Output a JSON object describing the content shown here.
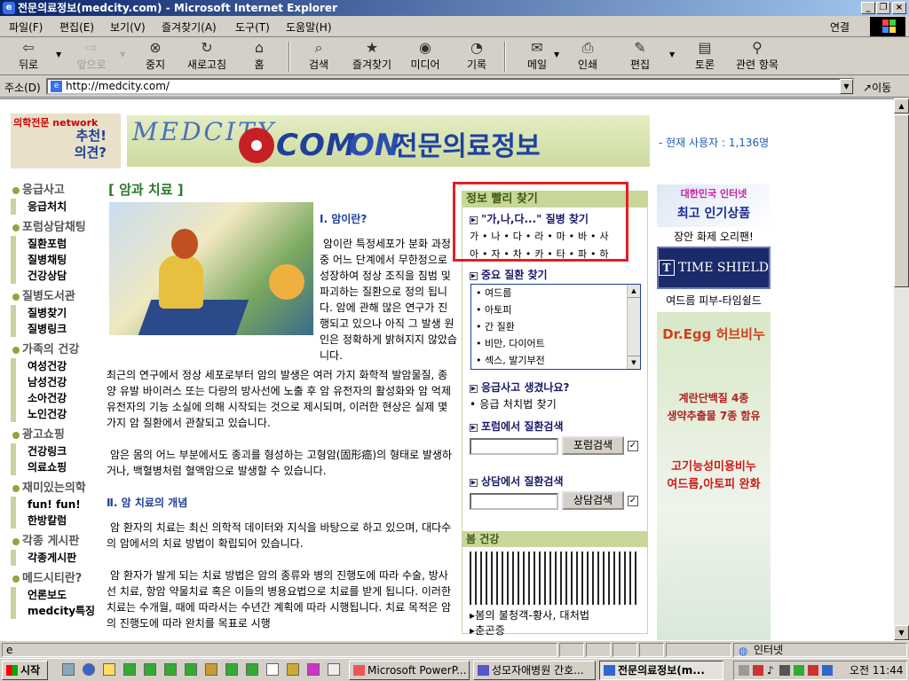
{
  "window": {
    "title": "전문의료정보(medcity.com) - Microsoft Internet Explorer"
  },
  "menu": [
    "파일(F)",
    "편집(E)",
    "보기(V)",
    "즐겨찾기(A)",
    "도구(T)",
    "도움말(H)"
  ],
  "menu_right": "연결",
  "toolbar": {
    "back": "뒤로",
    "forward": "앞으로",
    "stop": "중지",
    "refresh": "새로고침",
    "home": "홈",
    "search": "검색",
    "favorites": "즐겨찾기",
    "media": "미디어",
    "history": "기록",
    "mail": "메일",
    "print": "인쇄",
    "edit": "편집",
    "discuss": "토론",
    "related": "관련 항목"
  },
  "address": {
    "label": "주소(D)",
    "url": "http://medcity.com/",
    "go": "이동"
  },
  "header": {
    "pick_label": "의학전문 network",
    "pick_line1": "추천!",
    "pick_line2": "의견?",
    "banner_medcity": "MEDCITY",
    "banner_com": "COM",
    "banner_on": "ON",
    "banner_kr": "전문의료정보",
    "users": "- 현재 사용자 : 1,136명"
  },
  "nav": [
    {
      "head": "응급사고",
      "items": [
        "응급처치"
      ]
    },
    {
      "head": "포럼상담채팅",
      "items": [
        "질환포럼",
        "질병채팅",
        "건강상담"
      ]
    },
    {
      "head": "질병도서관",
      "items": [
        "질병찾기",
        "질병링크"
      ]
    },
    {
      "head": "가족의 건강",
      "items": [
        "여성건강",
        "남성건강",
        "소아건강",
        "노인건강"
      ]
    },
    {
      "head": "광고쇼핑",
      "items": [
        "건강링크",
        "의료쇼핑"
      ]
    },
    {
      "head": "재미있는의학",
      "items": [
        "fun! fun!",
        "한방칼럼"
      ]
    },
    {
      "head": "각종 게시판",
      "items": [
        "각종게시판"
      ]
    },
    {
      "head": "메드시티란?",
      "items": [
        "언론보도",
        "medcity특징"
      ]
    }
  ],
  "article": {
    "section_title": "[ 암과 치료 ]",
    "h1": "Ⅰ. 암이란?",
    "p1": "암이란 특정세포가 분화 과정 중 어느 단계에서 무한정으로 성장하여 정상 조직을 침범 및 파괴하는 질환으로 정의 됩니다. 암에 관해 많은 연구가 진행되고 있으나 아직 그 발생 원인은 정확하게 밝혀지지 않았습니다.",
    "p2": "최근의 연구에서 정상 세포로부터 암의 발생은 여러 가지 화학적 발암물질, 종양 유발 바이러스 또는 다량의 방사선에 노출 후 암 유전자의 활성화와 암 억제 유전자의 기능 소실에 의해 시작되는 것으로 제시되며, 이러한 현상은 실제 몇가지 암 질환에서 관찰되고 있습니다.",
    "p3": "암은 몸의 어느 부분에서도 종괴를 형성하는 고형암(固形癌)의 형태로 발생하거나, 백혈병처럼 혈액암으로 발생할 수 있습니다.",
    "h2": "Ⅱ. 암 치료의 개념",
    "p4": "암 환자의 치료는 최신 의학적 데이터와 지식을 바탕으로 하고 있으며, 대다수의 암에서의 치료 방법이 확립되어 있습니다.",
    "p5": "암 환자가 발게 되는 치료 방법은 암의 종류와 병의 진행도에 따라 수술, 방사선 치료, 항암 약물치료 혹은 이들의 병용요법으로 치료를 받게 됩니다. 이러한 치료는 수개월, 때에 따라서는 수년간 계획에 따라 시행됩니다. 치료 목적은 암의 진행도에 따라 완치를 목표로 시행"
  },
  "quickfind": {
    "title": "정보 빨리 찾기",
    "abc_title": "\"가,나,다...\" 질병 찾기",
    "row1": "가 • 나 • 다 • 라 • 마 • 바 • 사",
    "row2": "아 • 자 • 차 • 카 • 타 • 파 • 하",
    "major_title": "중요 질환 찾기",
    "diseases": [
      "• 여드름",
      "• 아토피",
      "• 간 질환",
      "• 비만, 다이어트",
      "• 섹스, 발기부전"
    ],
    "emergency_title": "응급사고 생겼나요?",
    "emergency_link": "• 응급 처치법 찾기",
    "forum_title": "포럼에서 질환검색",
    "forum_btn": "포럼검색",
    "consult_title": "상담에서 질환검색",
    "consult_btn": "상담검색",
    "spring_title": "봄 건강",
    "spring_link1": "봄의 불청객-황사, 대처법",
    "spring_link2": "춘곤증"
  },
  "ads": {
    "ad1_line1": "대한민국 인터넷",
    "ad1_line2": "최고 인기상품",
    "ad1_caption": "장안 화제 오리팬!",
    "ad2_text": "TIME SHIELD",
    "ad2_caption": "여드름 피부-타임쉴드",
    "ad3_brand": "Dr.Egg 허브비누",
    "ad3_line1": "계란단백질 4종",
    "ad3_line2": "생약추출물 7종 함유",
    "ad3_line3": "고기능성미용비누",
    "ad3_line4": "여드름,아토피 완화"
  },
  "status": {
    "zone": "인터넷"
  },
  "taskbar": {
    "start": "시작",
    "tasks": [
      "Microsoft PowerP...",
      "성모자애병원 간호...",
      "전문의료정보(m..."
    ],
    "clock": "오전 11:44"
  }
}
